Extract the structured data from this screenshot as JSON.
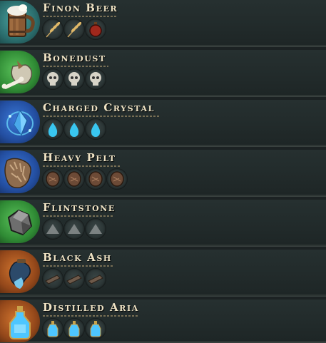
{
  "recipes": [
    {
      "name": "Finon Beer",
      "icon": "beer-mug-icon",
      "bg": "teal",
      "ingredients": [
        "wheat-icon",
        "wheat-icon",
        "red-potion-icon"
      ]
    },
    {
      "name": "Bonedust",
      "icon": "bone-sack-icon",
      "bg": "green",
      "ingredients": [
        "skull-icon",
        "skull-icon",
        "skull-icon"
      ]
    },
    {
      "name": "Charged Crystal",
      "icon": "charged-crystal-icon",
      "bg": "blue",
      "ingredients": [
        "water-drop-icon",
        "water-drop-icon",
        "water-drop-icon"
      ]
    },
    {
      "name": "Heavy Pelt",
      "icon": "fur-pelt-icon",
      "bg": "blue",
      "ingredients": [
        "hide-icon",
        "hide-icon",
        "hide-icon",
        "hide-icon"
      ]
    },
    {
      "name": "Flintstone",
      "icon": "flint-rock-icon",
      "bg": "green",
      "ingredients": [
        "stone-pile-icon",
        "stone-pile-icon",
        "stone-pile-icon"
      ]
    },
    {
      "name": "Black Ash",
      "icon": "ash-pouch-icon",
      "bg": "orange",
      "ingredients": [
        "plank-icon",
        "plank-icon",
        "plank-icon"
      ]
    },
    {
      "name": "Distilled Aria",
      "icon": "blue-flask-icon",
      "bg": "orange",
      "ingredients": [
        "blue-bottle-icon",
        "blue-bottle-icon",
        "blue-bottle-icon"
      ]
    }
  ]
}
